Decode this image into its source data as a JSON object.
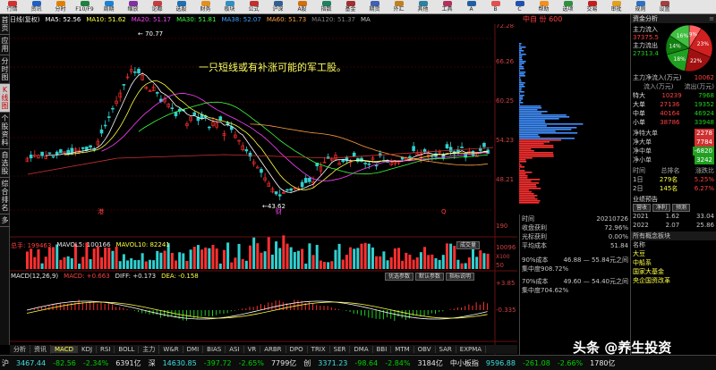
{
  "toolbar": {
    "items": [
      "行情",
      "资讯",
      "分时",
      "F10/F9",
      "周期",
      "缩放",
      "论都",
      "选股",
      "财务",
      "板块",
      "公式",
      "沪深",
      "A股",
      "指数",
      "基金",
      "期货",
      "外汇",
      "其他",
      "工具",
      "A",
      "B",
      "C",
      "帮助",
      "选项",
      "交易",
      "审批",
      "规则",
      "设置"
    ],
    "colors": [
      "#d03030",
      "#2060c0",
      "#e08000",
      "#208040",
      "#2080d0",
      "#8030a0",
      "#c04040",
      "#2070b0",
      "#e09020",
      "#3090c0",
      "#c03030",
      "#306090",
      "#d07010",
      "#208060",
      "#a03030",
      "#4060b0",
      "#c08020",
      "#3080a0",
      "#b03060",
      "#2060a0",
      "#e05050",
      "#2050b0",
      "#f09020",
      "#309040",
      "#c02020",
      "#e0a020",
      "#3070c0",
      "#a04040"
    ]
  },
  "left_tabs": [
    "首页",
    "应用",
    "分时图",
    "K线图",
    "个股资料",
    "自选股",
    "综合排名",
    "多"
  ],
  "stock": {
    "name_prefix": "日线(复权)",
    "ma_labels": [
      {
        "text": "MA5: 52.56",
        "color": "#ffffff"
      },
      {
        "text": "MA10: 51.62",
        "color": "#ffff40"
      },
      {
        "text": "MA20: 51.17",
        "color": "#ff40ff"
      },
      {
        "text": "MA30: 51.81",
        "color": "#40ff40"
      },
      {
        "text": "MA38: 52.07",
        "color": "#40a0ff"
      },
      {
        "text": "MA60: 51.73",
        "color": "#ffa040"
      },
      {
        "text": "MA120: 51.37",
        "color": "#808080"
      },
      {
        "text": "MA",
        "color": "#c0c0c0"
      }
    ],
    "title_right": "中自  份 600",
    "annotation": "一只短线或有补涨可能的军工股。",
    "price_high": "70.77",
    "price_low": "43.62",
    "y_axis": [
      "72.28",
      "66.26",
      "60.25",
      "54.23",
      "48.21"
    ],
    "markers": [
      "港",
      "财",
      "Q"
    ]
  },
  "volume": {
    "title": "总手: 199463",
    "mavol5": "MAVOL5: 100166",
    "mavol10": "MAVOL10: 82241",
    "btn": "成交量",
    "y_axis": [
      "190",
      "10096",
      "50"
    ],
    "unit_label": "X100"
  },
  "macd": {
    "title": "MACD(12,26,9)",
    "macd": "MACD: +0.663",
    "diff": "DIFF: +0.173",
    "dea": "DEA: -0.158",
    "btns": [
      "优选参数",
      "默认参数",
      "指标说明"
    ],
    "y_axis": [
      "+3.85",
      "-0.335"
    ]
  },
  "x_axis": [
    "11",
    "12",
    "01",
    "02",
    "03",
    "04",
    "05",
    "06",
    "07"
  ],
  "bottom_tabs": [
    "分析",
    "资讯",
    "MACD",
    "KDJ",
    "RSI",
    "BOLL",
    "主力",
    "W&R",
    "DMI",
    "BIAS",
    "ASI",
    "VR",
    "ARBR",
    "DPO",
    "TRIX",
    "SER",
    "DMA",
    "BBI",
    "MTM",
    "OBV",
    "SAR",
    "EXPMA"
  ],
  "status": [
    {
      "text": "沪",
      "color": "#e8e8e8"
    },
    {
      "text": "3467.44",
      "color": "#40e0e0"
    },
    {
      "text": "-82.56",
      "color": "#00d000"
    },
    {
      "text": "-2.34%",
      "color": "#00d000"
    },
    {
      "text": "6391亿",
      "color": "#e8e8e8"
    },
    {
      "text": "深",
      "color": "#e8e8e8"
    },
    {
      "text": "14630.85",
      "color": "#40e0e0"
    },
    {
      "text": "-397.72",
      "color": "#00d000"
    },
    {
      "text": "-2.65%",
      "color": "#00d000"
    },
    {
      "text": "7799亿",
      "color": "#e8e8e8"
    },
    {
      "text": "创",
      "color": "#e8e8e8"
    },
    {
      "text": "3371.23",
      "color": "#40e0e0"
    },
    {
      "text": "-98.64",
      "color": "#00d000"
    },
    {
      "text": "-2.84%",
      "color": "#00d000"
    },
    {
      "text": "3184亿",
      "color": "#e8e8e8"
    },
    {
      "text": "中小板指",
      "color": "#e8e8e8"
    },
    {
      "text": "9596.88",
      "color": "#40e0e0"
    },
    {
      "text": "-261.08",
      "color": "#00d000"
    },
    {
      "text": "-2.66%",
      "color": "#00d000"
    },
    {
      "text": "1780亿",
      "color": "#e8e8e8"
    }
  ],
  "chip": {
    "time_label": "时间",
    "time_value": "20210726",
    "rows": [
      {
        "label": "收盘获利",
        "value": "72.96%"
      },
      {
        "label": "光标获利",
        "value": "0.00%"
      },
      {
        "label": "平均成本",
        "value": "51.84"
      }
    ],
    "cost90": "90%成本",
    "cost90_range": "46.88 — 55.84元之间",
    "conc90": "集中度908.72%",
    "cost70": "70%成本",
    "cost70_range": "49.60 — 54.40元之间",
    "conc70": "集中度704.62%"
  },
  "right_panel": {
    "title": "资金分析",
    "pie_pcts": [
      "9%",
      "23%",
      "22%",
      "18%",
      "14%",
      "16%"
    ],
    "flows": [
      {
        "label": "主力流入",
        "value": "37375.5"
      },
      {
        "label": "主力流出",
        "value": "27313.4"
      }
    ],
    "net_label": "主力净流入(万元)",
    "net_value": "10062",
    "table_header": [
      "流入(万元)",
      "流出(万元)"
    ],
    "table_rows": [
      {
        "label": "特大",
        "in": "10239",
        "out": "7968"
      },
      {
        "label": "大单",
        "in": "27136",
        "out": "19352"
      },
      {
        "label": "中单",
        "in": "40164",
        "out": "46924"
      },
      {
        "label": "小单",
        "in": "38786",
        "out": "33948"
      }
    ],
    "net_rows": [
      {
        "label": "净特大单",
        "value": "2278",
        "color": "#d03030"
      },
      {
        "label": "净大单",
        "value": "7784",
        "color": "#d03030"
      },
      {
        "label": "净中单",
        "value": "-6820",
        "color": "#20a020"
      },
      {
        "label": "净小单",
        "value": "3242",
        "color": "#20a020"
      }
    ],
    "rank_header": [
      "时间",
      "总排名",
      "涨跌比"
    ],
    "rank_rows": [
      {
        "t": "1日",
        "rank": "279名",
        "pct": "5.25%"
      },
      {
        "t": "2日",
        "rank": "145名",
        "pct": "6.27%"
      }
    ],
    "perf_title": "业绩预告",
    "perf_tabs": [
      "营收",
      "净利",
      "预测"
    ],
    "perf_rows": [
      {
        "y": "2021",
        "a": "1.62",
        "b": "33.04"
      },
      {
        "y": "2022",
        "a": "2.07",
        "b": "25.86"
      }
    ],
    "concept_title": "所有概念板块",
    "concept_label": "名称",
    "concepts": [
      "大豆",
      "中船系",
      "国家大基金",
      "央企国资改革"
    ]
  },
  "watermark": "头条 @养生投资"
}
